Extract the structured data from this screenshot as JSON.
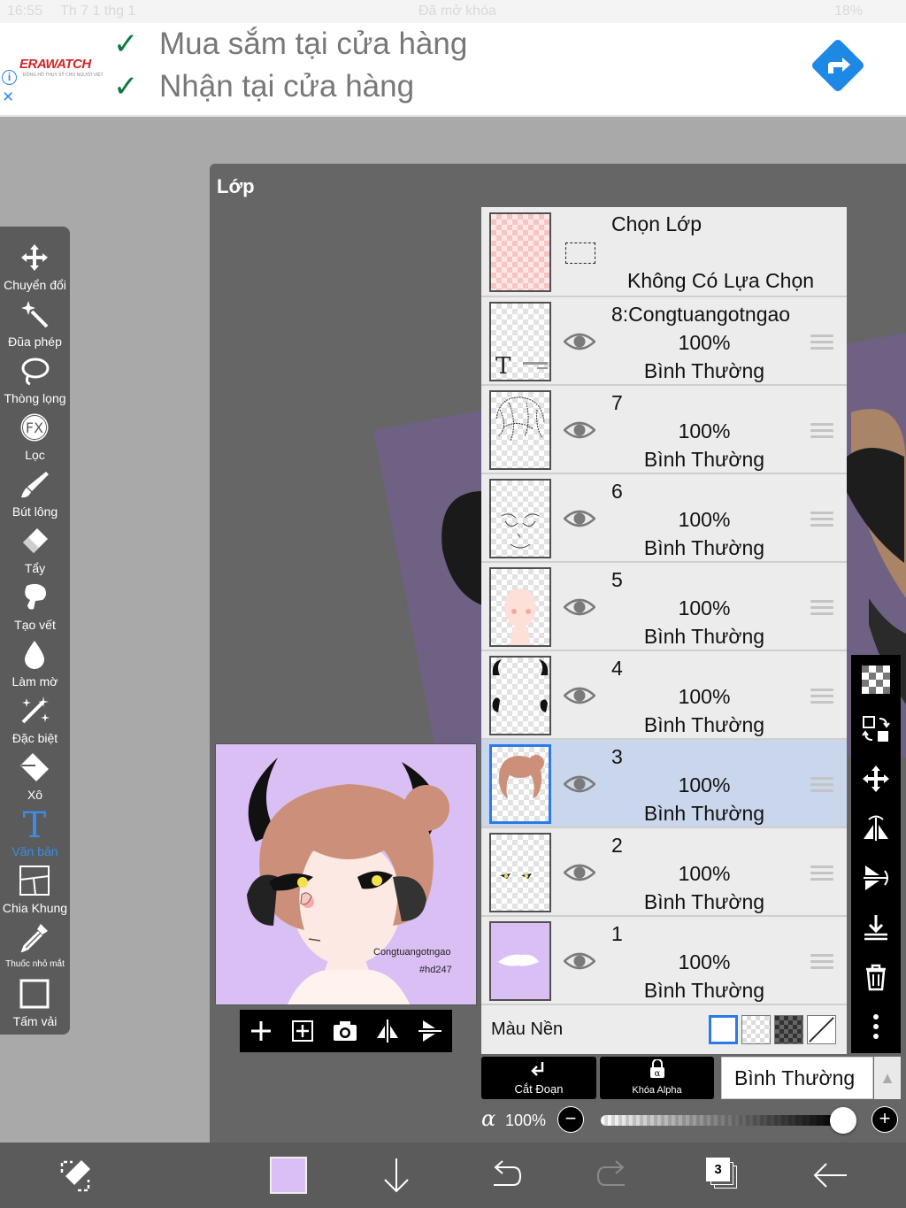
{
  "status_bar": {
    "time": "16:55",
    "date": "Th 7 1 thg 1",
    "center": "Đã mở khóa",
    "battery": "18%"
  },
  "ad": {
    "brand": "ERAWATCH",
    "brand_tagline": "ĐỒNG HỒ THỤY SỸ CHO NGƯỜI VIỆT",
    "line1": "Mua sắm tại cửa hàng",
    "line2": "Nhận tại cửa hàng",
    "info_symbol": "i",
    "close_symbol": "×"
  },
  "panel": {
    "title": "Lớp"
  },
  "toolbar": {
    "tools": [
      {
        "label": "Chuyển đổi",
        "icon": "move-arrows-icon"
      },
      {
        "label": "Đũa phép",
        "icon": "magic-wand-icon"
      },
      {
        "label": "Thòng lọng",
        "icon": "lasso-icon"
      },
      {
        "label": "Lọc",
        "icon": "fx-filter-icon",
        "glyph": "FX"
      },
      {
        "label": "Bút lông",
        "icon": "brush-icon"
      },
      {
        "label": "Tẩy",
        "icon": "eraser-icon"
      },
      {
        "label": "Tạo vết",
        "icon": "smudge-icon"
      },
      {
        "label": "Làm mờ",
        "icon": "blur-drop-icon"
      },
      {
        "label": "Đặc biệt",
        "icon": "special-sparkle-icon"
      },
      {
        "label": "Xô",
        "icon": "bucket-icon"
      },
      {
        "label": "Văn bản",
        "icon": "text-icon",
        "glyph": "T",
        "active": true
      },
      {
        "label": "Chia Khung",
        "icon": "frame-divider-icon"
      },
      {
        "label": "Thuốc nhỏ mắt",
        "icon": "eyedropper-icon"
      },
      {
        "label": "Tấm vải",
        "icon": "canvas-icon"
      }
    ]
  },
  "preview": {
    "signature": "Congtuangotngao",
    "tag": "#hd247",
    "bg_color": "#d9bff4"
  },
  "layers": {
    "selection": {
      "title": "Chọn Lớp",
      "status": "Không Có Lựa Chọn"
    },
    "items": [
      {
        "name": "8:Congtuangotngao",
        "opacity": "100%",
        "mode": "Bình Thường",
        "thumb": "text",
        "thumb_glyph": "T"
      },
      {
        "name": "7",
        "opacity": "100%",
        "mode": "Bình Thường",
        "thumb": "lineart-hair"
      },
      {
        "name": "6",
        "opacity": "100%",
        "mode": "Bình Thường",
        "thumb": "lineart-face"
      },
      {
        "name": "5",
        "opacity": "100%",
        "mode": "Bình Thường",
        "thumb": "skin"
      },
      {
        "name": "4",
        "opacity": "100%",
        "mode": "Bình Thường",
        "thumb": "horns"
      },
      {
        "name": "3",
        "opacity": "100%",
        "mode": "Bình Thường",
        "thumb": "hair",
        "selected": true
      },
      {
        "name": "2",
        "opacity": "100%",
        "mode": "Bình Thường",
        "thumb": "eyes"
      },
      {
        "name": "1",
        "opacity": "100%",
        "mode": "Bình Thường",
        "thumb": "background"
      }
    ],
    "background": {
      "label": "Màu Nền"
    }
  },
  "controls": {
    "clip_label": "Cắt Đoạn",
    "alpha_lock_label": "Khóa Alpha",
    "alpha_lock_glyph": "α",
    "blend_mode": "Bình Thường",
    "alpha_symbol": "α",
    "opacity": "100%",
    "opacity_value": 1.0,
    "minus": "−",
    "plus": "+"
  },
  "bottom": {
    "layer_count": "3",
    "current_color": "#d9bff4"
  },
  "colors": {
    "accent": "#2c7be5",
    "panel_dark": "#666666",
    "toolbar": "#5b5b5b",
    "selected_row": "#c9d6eb"
  }
}
